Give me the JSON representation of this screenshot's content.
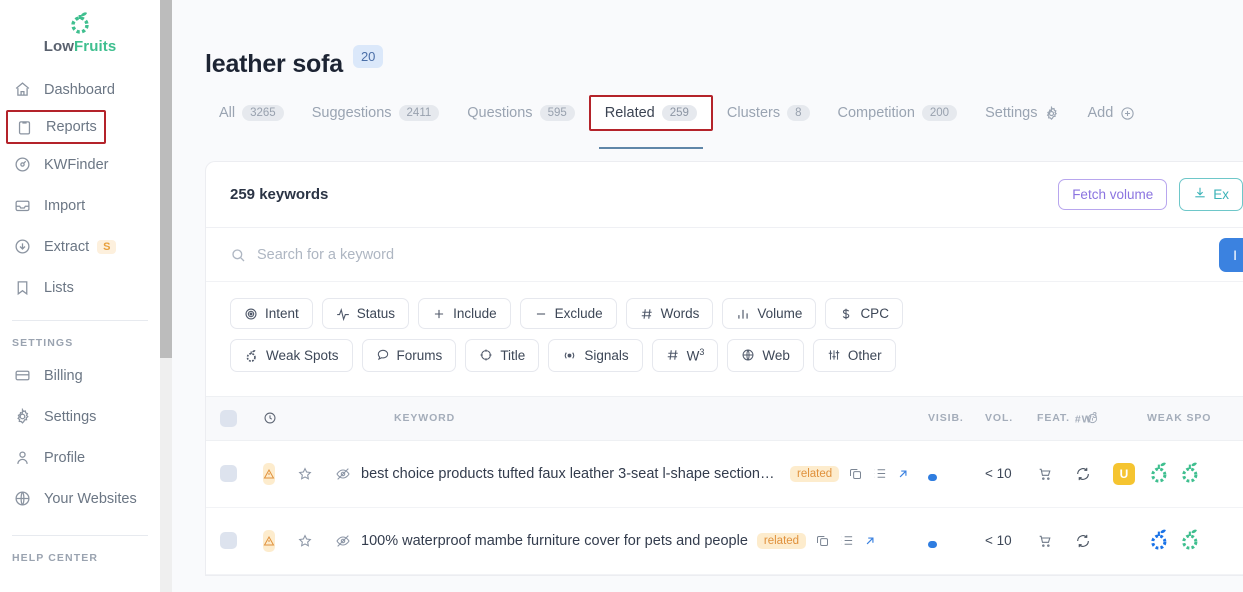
{
  "brand": {
    "low": "Low",
    "fruits": "Fruits",
    "logo_color": "#3fbf8f"
  },
  "sidebar": {
    "items": [
      {
        "label": "Dashboard",
        "icon": "home-icon"
      },
      {
        "label": "Reports",
        "icon": "clipboard-icon",
        "highlighted": true
      },
      {
        "label": "KWFinder",
        "icon": "compass-icon"
      },
      {
        "label": "Import",
        "icon": "inbox-icon"
      },
      {
        "label": "Extract",
        "icon": "download-circle-icon",
        "badge": "S"
      },
      {
        "label": "Lists",
        "icon": "bookmark-icon"
      }
    ],
    "settings_label": "SETTINGS",
    "settings_items": [
      {
        "label": "Billing",
        "icon": "card-icon"
      },
      {
        "label": "Settings",
        "icon": "gear-icon"
      },
      {
        "label": "Profile",
        "icon": "person-icon"
      },
      {
        "label": "Your Websites",
        "icon": "globe-icon"
      }
    ],
    "help_label": "HELP CENTER",
    "highlight_color": "#b4232a"
  },
  "header": {
    "title": "leather sofa",
    "title_count": "20"
  },
  "tabs": [
    {
      "label": "All",
      "count": "3265",
      "state": "inactive"
    },
    {
      "label": "Suggestions",
      "count": "2411",
      "state": "inactive"
    },
    {
      "label": "Questions",
      "count": "595",
      "state": "inactive"
    },
    {
      "label": "Related",
      "count": "259",
      "state": "active"
    },
    {
      "label": "Clusters",
      "count": "8",
      "state": "inactive"
    },
    {
      "label": "Competition",
      "count": "200",
      "state": "inactive"
    },
    {
      "label": "Settings",
      "count": "",
      "state": "inactive",
      "icon": "gear-icon"
    },
    {
      "label": "Add",
      "count": "",
      "state": "inactive",
      "icon": "plus-circle-icon"
    }
  ],
  "card": {
    "keyword_count": "259 keywords",
    "fetch_volume_label": "Fetch volume",
    "export_label": "Ex",
    "search_placeholder": "Search for a keyword",
    "search_value": "",
    "submit_label": "I"
  },
  "filters": {
    "row1": [
      {
        "label": "Intent",
        "icon": "target-icon"
      },
      {
        "label": "Status",
        "icon": "activity-icon"
      },
      {
        "label": "Include",
        "icon": "plus-icon"
      },
      {
        "label": "Exclude",
        "icon": "minus-icon"
      },
      {
        "label": "Words",
        "icon": "hash-icon"
      },
      {
        "label": "Volume",
        "icon": "bars-icon"
      },
      {
        "label": "CPC",
        "icon": "dollar-icon"
      }
    ],
    "row2": [
      {
        "label": "Weak Spots",
        "icon": "fruit-icon"
      },
      {
        "label": "Forums",
        "icon": "speech-icon"
      },
      {
        "label": "Title",
        "icon": "crosshair-icon"
      },
      {
        "label": "Signals",
        "icon": "broadcast-icon"
      },
      {
        "label": "W",
        "icon": "hash-icon",
        "sup": "3"
      },
      {
        "label": "Web",
        "icon": "globe-icon"
      },
      {
        "label": "Other",
        "icon": "sliders-icon"
      }
    ]
  },
  "table": {
    "headers": {
      "keyword": "KEYWORD",
      "visib": "VISIB.",
      "vol": "VOL.",
      "feat": "FEAT.",
      "w3": "#W",
      "w3_sup": "3",
      "weak": "WEAK SPO"
    },
    "rows": [
      {
        "keyword": "best choice products tufted faux leather 3-seat l-shape sectional...",
        "tag": "related",
        "volume": "< 10",
        "visibility_pct": 22,
        "has_u_badge": true,
        "u_label": "U",
        "fruits": [
          "green",
          "green"
        ]
      },
      {
        "keyword": "100% waterproof mambe furniture cover for pets and people",
        "tag": "related",
        "volume": "< 10",
        "visibility_pct": 22,
        "has_u_badge": false,
        "u_label": "",
        "fruits": [
          "blue",
          "green"
        ]
      }
    ]
  }
}
